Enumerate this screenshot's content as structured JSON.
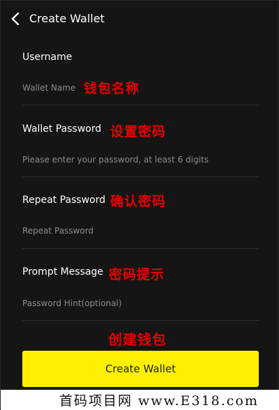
{
  "header": {
    "title": "Create Wallet",
    "back_icon": "chevron-left-icon"
  },
  "fields": [
    {
      "label": "Username",
      "placeholder": "Wallet Name",
      "annotation": "钱包名称"
    },
    {
      "label": "Wallet Password",
      "placeholder": "Please enter your password, at least 6 digits",
      "annotation": "设置密码"
    },
    {
      "label": "Repeat Password",
      "placeholder": "Repeat Password",
      "annotation": "确认密码"
    },
    {
      "label": "Prompt Message",
      "placeholder": "Password Hint(optional)",
      "annotation": "密码提示"
    }
  ],
  "create_annotation": "创建钱包",
  "create_button_label": "Create Wallet",
  "watermark": "首码项目网 www.E318.com",
  "colors": {
    "background": "#151515",
    "accent": "#ffef00",
    "annotation": "#e60000"
  }
}
